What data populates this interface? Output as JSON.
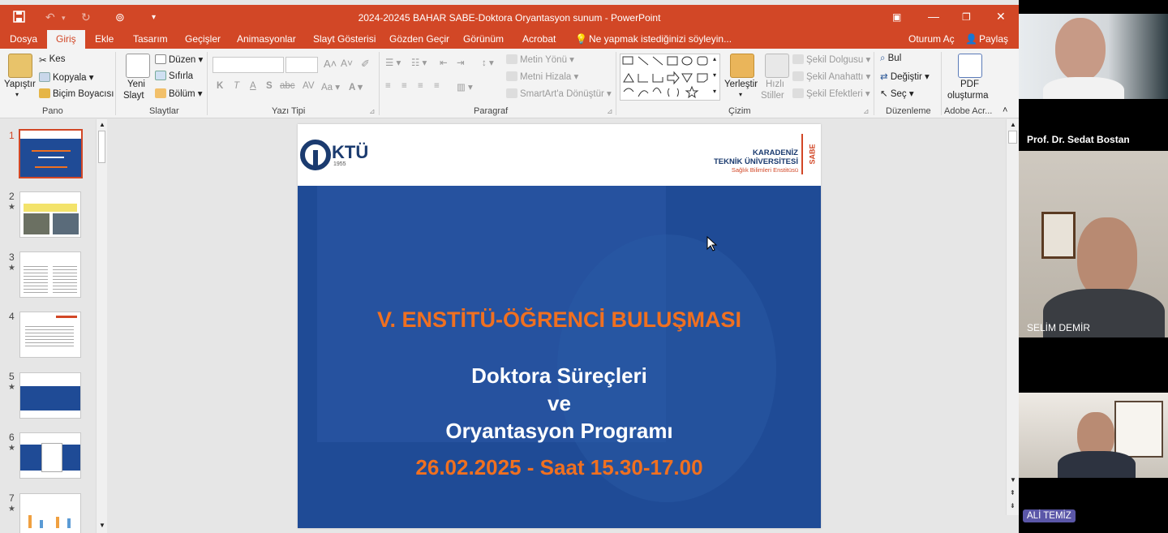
{
  "window": {
    "title": "2024-20245 BAHAR SABE-Doktora Oryantasyon sunum  -  PowerPoint"
  },
  "menu": {
    "tabs": [
      "Dosya",
      "Giriş",
      "Ekle",
      "Tasarım",
      "Geçişler",
      "Animasyonlar",
      "Slayt Gösterisi",
      "Gözden Geçir",
      "Görünüm",
      "Acrobat"
    ],
    "active_tab": "Giriş",
    "tell_me": "Ne yapmak istediğinizi söyleyin...",
    "sign_in": "Oturum Aç",
    "share": "Paylaş"
  },
  "ribbon": {
    "pano": {
      "paste": "Yapıştır",
      "cut": "Kes",
      "copy": "Kopyala",
      "format_painter": "Biçim Boyacısı",
      "label": "Pano"
    },
    "slaytlar": {
      "new_slide_1": "Yeni",
      "new_slide_2": "Slayt",
      "layout": "Düzen",
      "reset": "Sıfırla",
      "section": "Bölüm",
      "label": "Slaytlar"
    },
    "yazi_tipi": {
      "label": "Yazı Tipi"
    },
    "paragraf": {
      "text_direction": "Metin Yönü",
      "align_text": "Metni Hizala",
      "smartart": "SmartArt'a Dönüştür",
      "label": "Paragraf"
    },
    "cizim": {
      "arrange": "Yerleştir",
      "quick_styles_1": "Hızlı",
      "quick_styles_2": "Stiller",
      "shape_fill": "Şekil Dolgusu",
      "shape_outline": "Şekil Anahattı",
      "shape_effects": "Şekil Efektleri",
      "label": "Çizim"
    },
    "duzenleme": {
      "find": "Bul",
      "replace": "Değiştir",
      "select": "Seç",
      "label": "Düzenleme"
    },
    "adobe": {
      "pdf_1": "PDF",
      "pdf_2": "oluşturma",
      "label": "Adobe Acr..."
    }
  },
  "thumbnails": [
    {
      "n": "1",
      "star": false
    },
    {
      "n": "2",
      "star": true
    },
    {
      "n": "3",
      "star": true
    },
    {
      "n": "4",
      "star": false
    },
    {
      "n": "5",
      "star": true
    },
    {
      "n": "6",
      "star": true
    },
    {
      "n": "7",
      "star": true
    }
  ],
  "slide": {
    "logo_text": "KTÜ",
    "logo_year": "1955",
    "uni_line1": "KARADENİZ",
    "uni_line2": "TEKNİK ÜNİVERSİTESİ",
    "uni_line3": "Sağlık Bilimleri Enstitüsü",
    "uni_vertical": "SABE",
    "heading": "V. ENSTİTÜ-ÖĞRENCİ BULUŞMASI",
    "line1": "Doktora Süreçleri",
    "line2": "ve",
    "line3": "Oryantasyon Programı",
    "date_line": "26.02.2025 - Saat 15.30-17.00"
  },
  "participants": [
    {
      "name": "Prof. Dr. Sedat Bostan"
    },
    {
      "name": "SELİM DEMİR"
    },
    {
      "name": "ALİ TEMİZ"
    }
  ],
  "colors": {
    "accent": "#d24726",
    "slide_blue": "#1f4b96",
    "slide_orange": "#f07020"
  }
}
